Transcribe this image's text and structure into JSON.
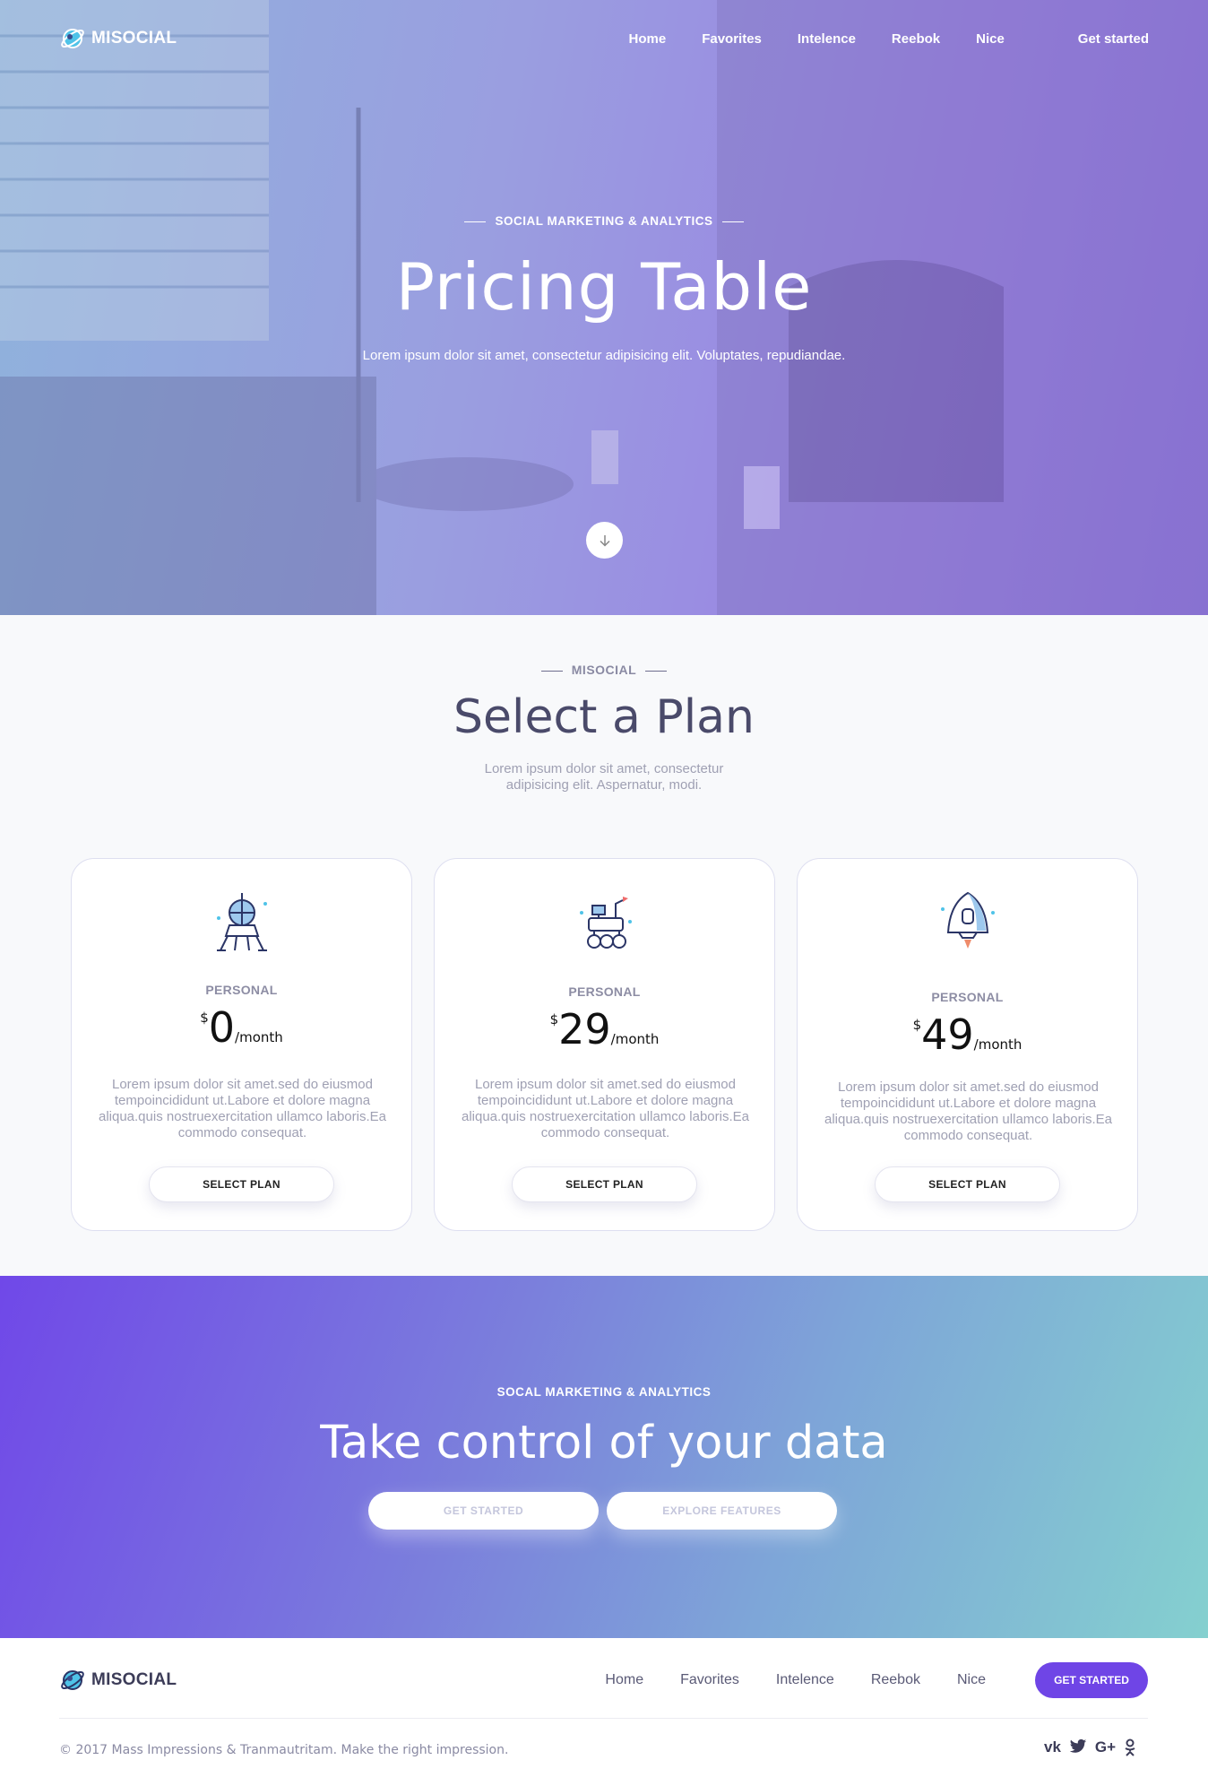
{
  "brand": {
    "name": "MISOCIAL"
  },
  "nav": {
    "items": [
      "Home",
      "Favorites",
      "Intelence",
      "Reebok",
      "Nice"
    ],
    "cta": "Get started"
  },
  "hero": {
    "eyebrow": "SOCIAL MARKETING & ANALYTICS",
    "title": "Pricing Table",
    "subtitle": "Lorem ipsum dolor sit amet, consectetur adipisicing elit. Voluptates, repudiandae.",
    "scroll_icon": "arrow-down-icon"
  },
  "plans": {
    "eyebrow": "MISOCIAL",
    "title": "Select a Plan",
    "subtitle": "Lorem ipsum dolor sit amet, consectetur adipisicing elit. Aspernatur, modi.",
    "cards": [
      {
        "icon": "lunar-lander-icon",
        "tier": "PERSONAL",
        "currency": "$",
        "amount": "0",
        "period": "/month",
        "description": "Lorem ipsum dolor sit amet.sed do eiusmod tempoincididunt ut.Labore et dolore magna aliqua.quis nostruexercitation ullamco laboris.Ea commodo consequat.",
        "button": "SELECT PLAN"
      },
      {
        "icon": "rover-icon",
        "tier": "PERSONAL",
        "currency": "$",
        "amount": "29",
        "period": "/month",
        "description": "Lorem ipsum dolor sit amet.sed do eiusmod tempoincididunt ut.Labore et dolore magna aliqua.quis nostruexercitation ullamco laboris.Ea commodo consequat.",
        "button": "SELECT PLAN"
      },
      {
        "icon": "space-capsule-icon",
        "tier": "PERSONAL",
        "currency": "$",
        "amount": "49",
        "period": "/month",
        "description": "Lorem ipsum dolor sit amet.sed do eiusmod tempoincididunt ut.Labore et dolore magna aliqua.quis nostruexercitation ullamco laboris.Ea commodo consequat.",
        "button": "SELECT PLAN"
      }
    ]
  },
  "cta": {
    "eyebrow": "SOCAL MARKETING & ANALYTICS",
    "title": "Take control of your data",
    "primary": "GET STARTED",
    "secondary": "EXPLORE FEATURES"
  },
  "footer": {
    "nav": [
      "Home",
      "Favorites",
      "Intelence",
      "Reebok",
      "Nice"
    ],
    "cta": "GET STARTED",
    "copyright": "© 2017 Mass Impressions & Tranmautritam. Make the right impression.",
    "social": [
      "vk-icon",
      "twitter-icon",
      "google-plus-icon",
      "odnoklassniki-icon"
    ]
  },
  "colors": {
    "accent": "#6f45e6",
    "heading": "#4a4a6a",
    "muted": "#9fa0b3"
  }
}
